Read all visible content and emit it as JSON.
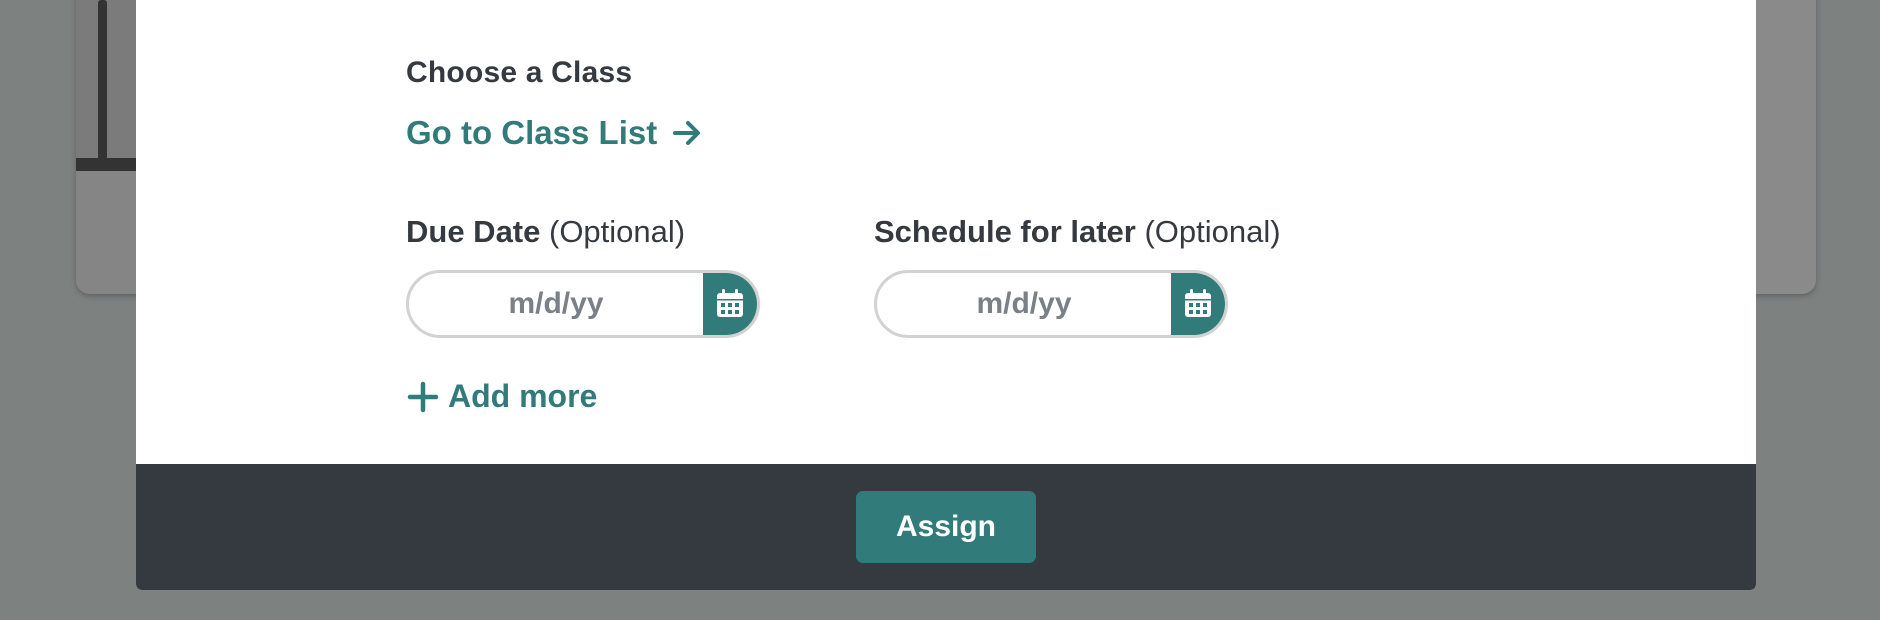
{
  "background": {
    "overlay_color": "#7d8180"
  },
  "modal": {
    "section_title": "Choose a Class",
    "class_list_link": {
      "label": "Go to Class List",
      "icon": "arrow-right-icon"
    },
    "due_date": {
      "label": "Due Date",
      "optional": "(Optional)",
      "placeholder": "m/d/yy",
      "icon": "calendar-icon"
    },
    "schedule_later": {
      "label": "Schedule for later",
      "optional": "(Optional)",
      "placeholder": "m/d/yy",
      "icon": "calendar-icon"
    },
    "add_more": {
      "label": "Add more",
      "icon": "plus-icon"
    },
    "footer": {
      "assign_label": "Assign"
    }
  },
  "colors": {
    "accent": "#317b7a",
    "footer": "#353a41",
    "text": "#353a40",
    "placeholder": "#7a8088"
  }
}
